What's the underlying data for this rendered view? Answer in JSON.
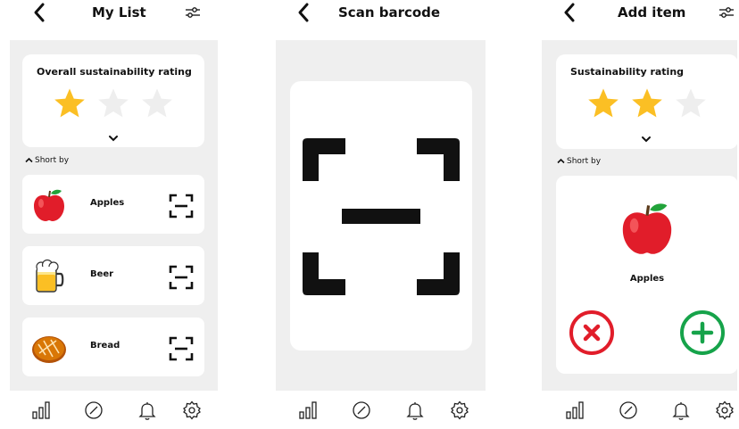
{
  "screens": [
    {
      "title": "My List",
      "rating_title": "Overall sustainability rating",
      "rating": {
        "value": 1,
        "max": 3
      },
      "sort_label": "Short by",
      "items": [
        {
          "name": "Apples",
          "icon": "apple-icon"
        },
        {
          "name": "Beer",
          "icon": "beer-mug-icon"
        },
        {
          "name": "Bread",
          "icon": "bread-icon"
        }
      ]
    },
    {
      "title": "Scan barcode"
    },
    {
      "title": "Add item",
      "rating_title": "Sustainability rating",
      "rating": {
        "value": 2,
        "max": 3
      },
      "sort_label": "Short by",
      "item_name": "Apples",
      "item_icon": "apple-icon"
    }
  ],
  "tabs": [
    "stats-icon",
    "compass-icon",
    "bell-icon",
    "settings-icon"
  ],
  "colors": {
    "star_filled": "#fbbf24",
    "star_empty": "#eeeeee",
    "panel_bg": "#efefef",
    "cancel": "#e11d2a",
    "add": "#16a34a"
  }
}
